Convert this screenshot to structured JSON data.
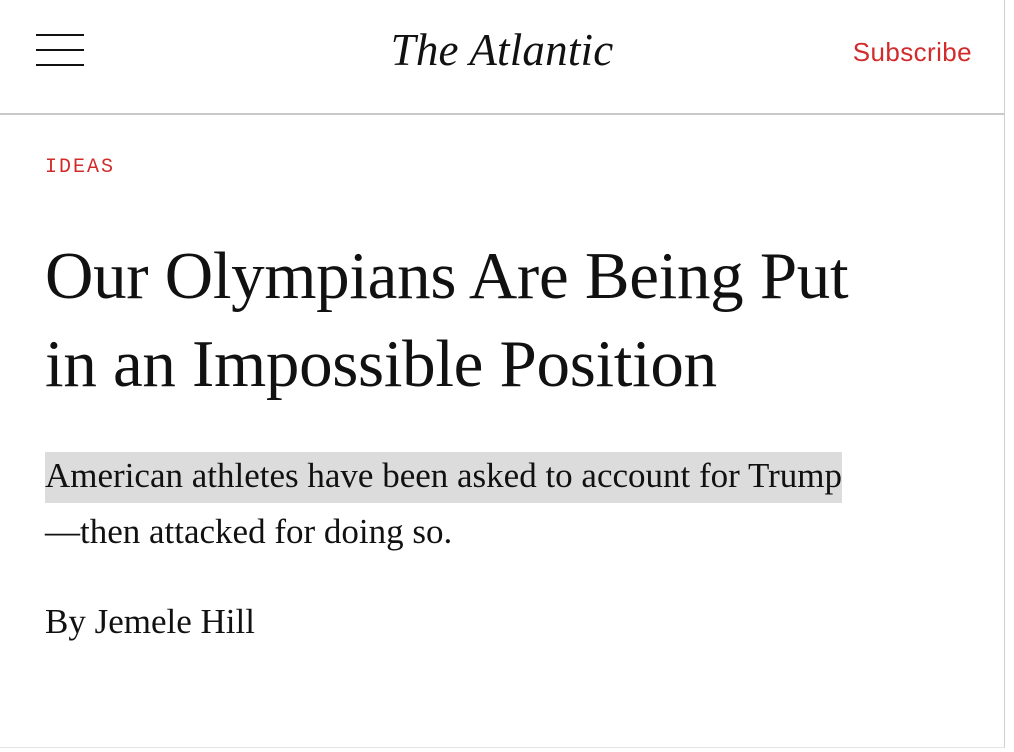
{
  "header": {
    "logo": "The Atlantic",
    "subscribe_label": "Subscribe",
    "menu_icon": "hamburger-menu-icon"
  },
  "article": {
    "section": "IDEAS",
    "headline_line1": "Our Olympians Are Being Put",
    "headline_line2": "in an Impossible Position",
    "dek_highlighted": "American athletes have been asked to account for Trump",
    "dek_rest": "—then attacked for doing so.",
    "byline_prefix": "By",
    "author": "Jemele Hill"
  },
  "colors": {
    "accent_red": "#d22b2b",
    "text": "#111111",
    "highlight": "#dcdcdc"
  }
}
